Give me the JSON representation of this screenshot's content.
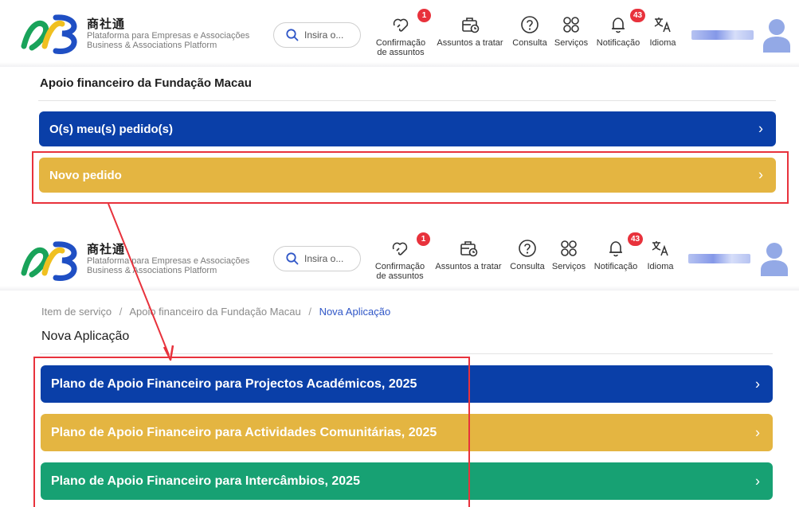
{
  "header": {
    "brand_cn": "商社通",
    "brand_pt": "Plataforma para Empresas e Associações",
    "brand_en": "Business & Associations Platform",
    "search_placeholder": "Insira o...",
    "nav": {
      "confirm_line1": "Confirmação",
      "confirm_line2": "de assuntos",
      "confirm_badge": "1",
      "tasks": "Assuntos a tratar",
      "consult": "Consulta",
      "services": "Serviços",
      "notifications": "Notificação",
      "notifications_badge": "43",
      "language": "Idioma"
    }
  },
  "screen1": {
    "title": "Apoio financeiro da Fundação Macau",
    "my_requests": "O(s) meu(s) pedido(s)",
    "new_request": "Novo pedido"
  },
  "screen2": {
    "breadcrumb": [
      "Item de serviço",
      "Apoio financeiro da Fundação Macau",
      "Nova Aplicação"
    ],
    "title": "Nova Aplicação",
    "plans": [
      "Plano de Apoio Financeiro para Projectos Académicos, 2025",
      "Plano de Apoio Financeiro para Actividades Comunitárias, 2025",
      "Plano de Apoio Financeiro para Intercâmbios, 2025"
    ]
  },
  "chevron": "›",
  "colors": {
    "blue": "#0a3fa8",
    "yellow": "#e4b541",
    "green": "#17a173",
    "badge": "#e8323c",
    "highlight": "#e8323c"
  }
}
